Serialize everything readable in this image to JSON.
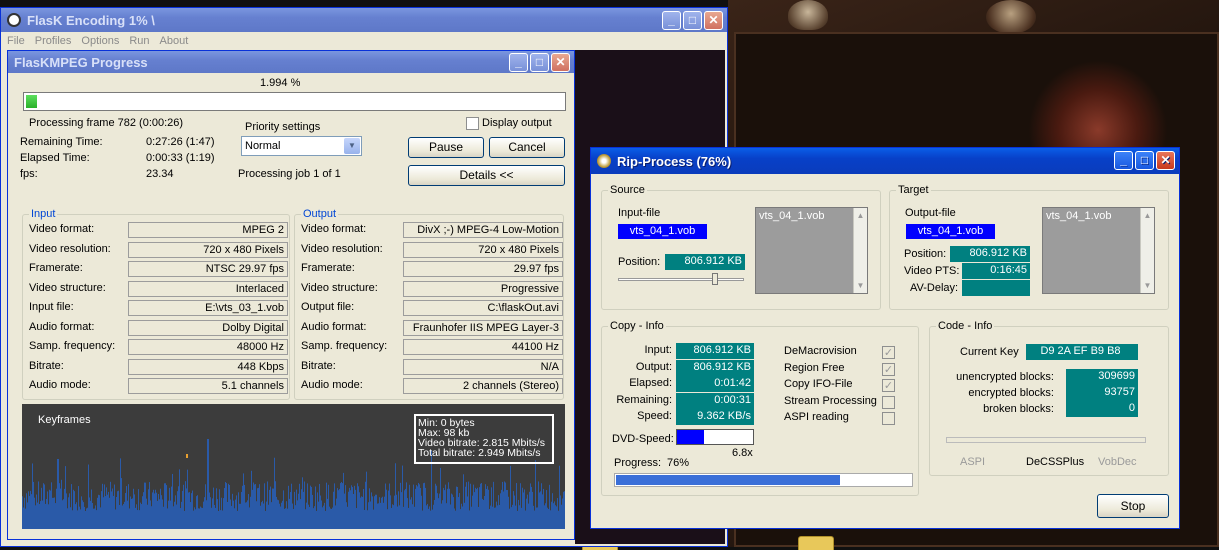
{
  "flask": {
    "title": "FlasK Encoding 1% \\",
    "menu": [
      "File",
      "Profiles",
      "Options",
      "Run",
      "About"
    ]
  },
  "progress": {
    "title": "FlasKMPEG Progress",
    "percent": "1.994 %",
    "fraction": 0.01994,
    "frame": "Processing frame 782 (0:00:26)",
    "display_output": "Display output",
    "remaining_label": "Remaining Time:",
    "remaining": "0:27:26 (1:47)",
    "elapsed_label": "Elapsed Time:",
    "elapsed": "0:00:33 (1:19)",
    "fps_label": "fps:",
    "fps": "23.34",
    "priority_label": "Priority settings",
    "priority": "Normal",
    "job": "Processing job 1 of 1",
    "pause": "Pause",
    "cancel": "Cancel",
    "details": "Details <<",
    "input_title": "Input",
    "output_title": "Output",
    "input_rows": [
      {
        "label": "Video format:",
        "value": "MPEG 2"
      },
      {
        "label": "Video resolution:",
        "value": "720 x 480 Pixels"
      },
      {
        "label": "Framerate:",
        "value": "NTSC 29.97 fps"
      },
      {
        "label": "Video structure:",
        "value": "Interlaced"
      },
      {
        "label": "Input file:",
        "value": "E:\\vts_03_1.vob"
      },
      {
        "label": "Audio format:",
        "value": "Dolby Digital"
      },
      {
        "label": "Samp. frequency:",
        "value": "48000 Hz"
      },
      {
        "label": "Bitrate:",
        "value": "448 Kbps"
      },
      {
        "label": "Audio mode:",
        "value": "5.1 channels"
      }
    ],
    "output_rows": [
      {
        "label": "Video format:",
        "value": "DivX ;-) MPEG-4 Low-Motion"
      },
      {
        "label": "Video resolution:",
        "value": "720 x 480 Pixels"
      },
      {
        "label": "Framerate:",
        "value": "29.97 fps"
      },
      {
        "label": "Video structure:",
        "value": "Progressive"
      },
      {
        "label": "Output file:",
        "value": "C:\\flaskOut.avi"
      },
      {
        "label": "Audio format:",
        "value": "Fraunhofer IIS MPEG Layer-3"
      },
      {
        "label": "Samp. frequency:",
        "value": "44100 Hz"
      },
      {
        "label": "Bitrate:",
        "value": "N/A"
      },
      {
        "label": "Audio mode:",
        "value": "2 channels (Stereo)"
      }
    ],
    "keyframes": "Keyframes",
    "stats": [
      "Min: 0 bytes",
      "Max: 98 kb",
      "Video bitrate: 2.815 Mbits/s",
      "Total bitrate: 2.949 Mbits/s"
    ]
  },
  "rip": {
    "title": "Rip-Process (76%)",
    "source_label": "Source",
    "target_label": "Target",
    "input_file_label": "Input-file",
    "input_file": "vts_04_1.vob",
    "position_label": "Position:",
    "src_position": "806.912 KB",
    "src_list": "vts_04_1.vob",
    "output_file_label": "Output-file",
    "output_file": "vts_04_1.vob",
    "tgt_position": "806.912 KB",
    "video_pts_label": "Video PTS:",
    "video_pts": "0:16:45",
    "av_delay_label": "AV-Delay:",
    "tgt_list": "vts_04_1.vob",
    "copy_info_label": "Copy - Info",
    "copy_rows": [
      {
        "label": "Input:",
        "value": "806.912 KB"
      },
      {
        "label": "Output:",
        "value": "806.912 KB"
      },
      {
        "label": "Elapsed:",
        "value": "0:01:42"
      },
      {
        "label": "Remaining:",
        "value": "0:00:31"
      },
      {
        "label": "Speed:",
        "value": "9.362 KB/s"
      }
    ],
    "dvd_speed_label": "DVD-Speed:",
    "dvd_speed": "6.8x",
    "options": [
      {
        "label": "DeMacrovision",
        "checked": true
      },
      {
        "label": "Region Free",
        "checked": true
      },
      {
        "label": "Copy IFO-File",
        "checked": true
      },
      {
        "label": "Stream Processing",
        "checked": false
      },
      {
        "label": "ASPI reading",
        "checked": false
      }
    ],
    "progress_label": "Progress:",
    "progress_pct": "76%",
    "progress_fraction": 0.76,
    "code_info_label": "Code - Info",
    "current_key_label": "Current Key",
    "current_key": "D9 2A EF B9 B8",
    "unencrypted_label": "unencrypted blocks:",
    "unencrypted": "309699",
    "encrypted_label": "encrypted blocks:",
    "encrypted": "93757",
    "broken_label": "broken blocks:",
    "broken": "0",
    "aspi": "ASPI",
    "decss": "DeCSSPlus",
    "vobdec": "VobDec",
    "stop": "Stop"
  }
}
